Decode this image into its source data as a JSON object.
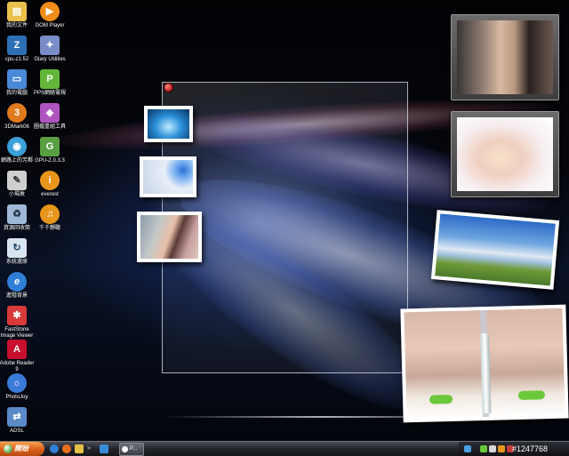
{
  "desktop_icons": [
    {
      "name": "my-documents-icon",
      "label": "我的文件",
      "color": "#e8c04a",
      "glyph": "▤"
    },
    {
      "name": "gom-player-icon",
      "label": "GOM Player",
      "color": "#f08c18",
      "glyph": "▶"
    },
    {
      "name": "cpu-z-icon",
      "label": "cpu-z1.52",
      "color": "#2d6fb5",
      "glyph": "Z"
    },
    {
      "name": "glary-utilities-icon",
      "label": "Glary Utilities",
      "color": "#7a8cc8",
      "glyph": "✦"
    },
    {
      "name": "my-computer-icon",
      "label": "我的電腦",
      "color": "#4a88d8",
      "glyph": "▭"
    },
    {
      "name": "pps-icon",
      "label": "PPS網絡電視",
      "color": "#63b63a",
      "glyph": "P"
    },
    {
      "name": "3dmark-icon",
      "label": "3DMark06",
      "color": "#e07a1c",
      "glyph": "3"
    },
    {
      "name": "image-tool-icon",
      "label": "圖檔重組工具",
      "color": "#b055c0",
      "glyph": "◆"
    },
    {
      "name": "network-places-icon",
      "label": "網路上的芳鄰",
      "color": "#3aa0d8",
      "glyph": "◉"
    },
    {
      "name": "gpu-z-icon",
      "label": "GPU-Z.0.3.3",
      "color": "#5a9e44",
      "glyph": "G"
    },
    {
      "name": "xiao-mamu-icon",
      "label": "小瑪敦",
      "color": "#cfcfcf",
      "glyph": "✎"
    },
    {
      "name": "everest-icon",
      "label": "everest",
      "color": "#e8951c",
      "glyph": "i"
    },
    {
      "name": "recycle-bin-icon",
      "label": "資源回收筒",
      "color": "#9fb8d8",
      "glyph": "♻"
    },
    {
      "name": "qianqian-icon",
      "label": "千千靜聽",
      "color": "#e8951c",
      "glyph": "♫"
    },
    {
      "name": "system-restore-icon",
      "label": "系統還原",
      "color": "#d8e4f0",
      "glyph": "↻"
    },
    {
      "name": "internet-explorer-icon",
      "label": "進階背景",
      "color": "#2f7fd8",
      "glyph": "e"
    },
    {
      "name": "faststone-icon",
      "label": "FastStone Image Viewer",
      "color": "#d83a3a",
      "glyph": "✱"
    },
    {
      "name": "adobe-reader-icon",
      "label": "Adobe Reader 9",
      "color": "#c8102e",
      "glyph": "A"
    },
    {
      "name": "photojoy-icon",
      "label": "PhotoJoy",
      "color": "#3a7ad8",
      "glyph": "☼"
    },
    {
      "name": "adsl-icon",
      "label": "ADSL",
      "color": "#5a8ac8",
      "glyph": "⇄"
    }
  ],
  "taskbar": {
    "start_label": "開始",
    "task_label": "P...",
    "clock": "#1247768"
  },
  "colors": {
    "taskbar_dark": "#16171b",
    "start_orange": "#d9601b",
    "wallpaper_blue": "#6f8fe0"
  }
}
